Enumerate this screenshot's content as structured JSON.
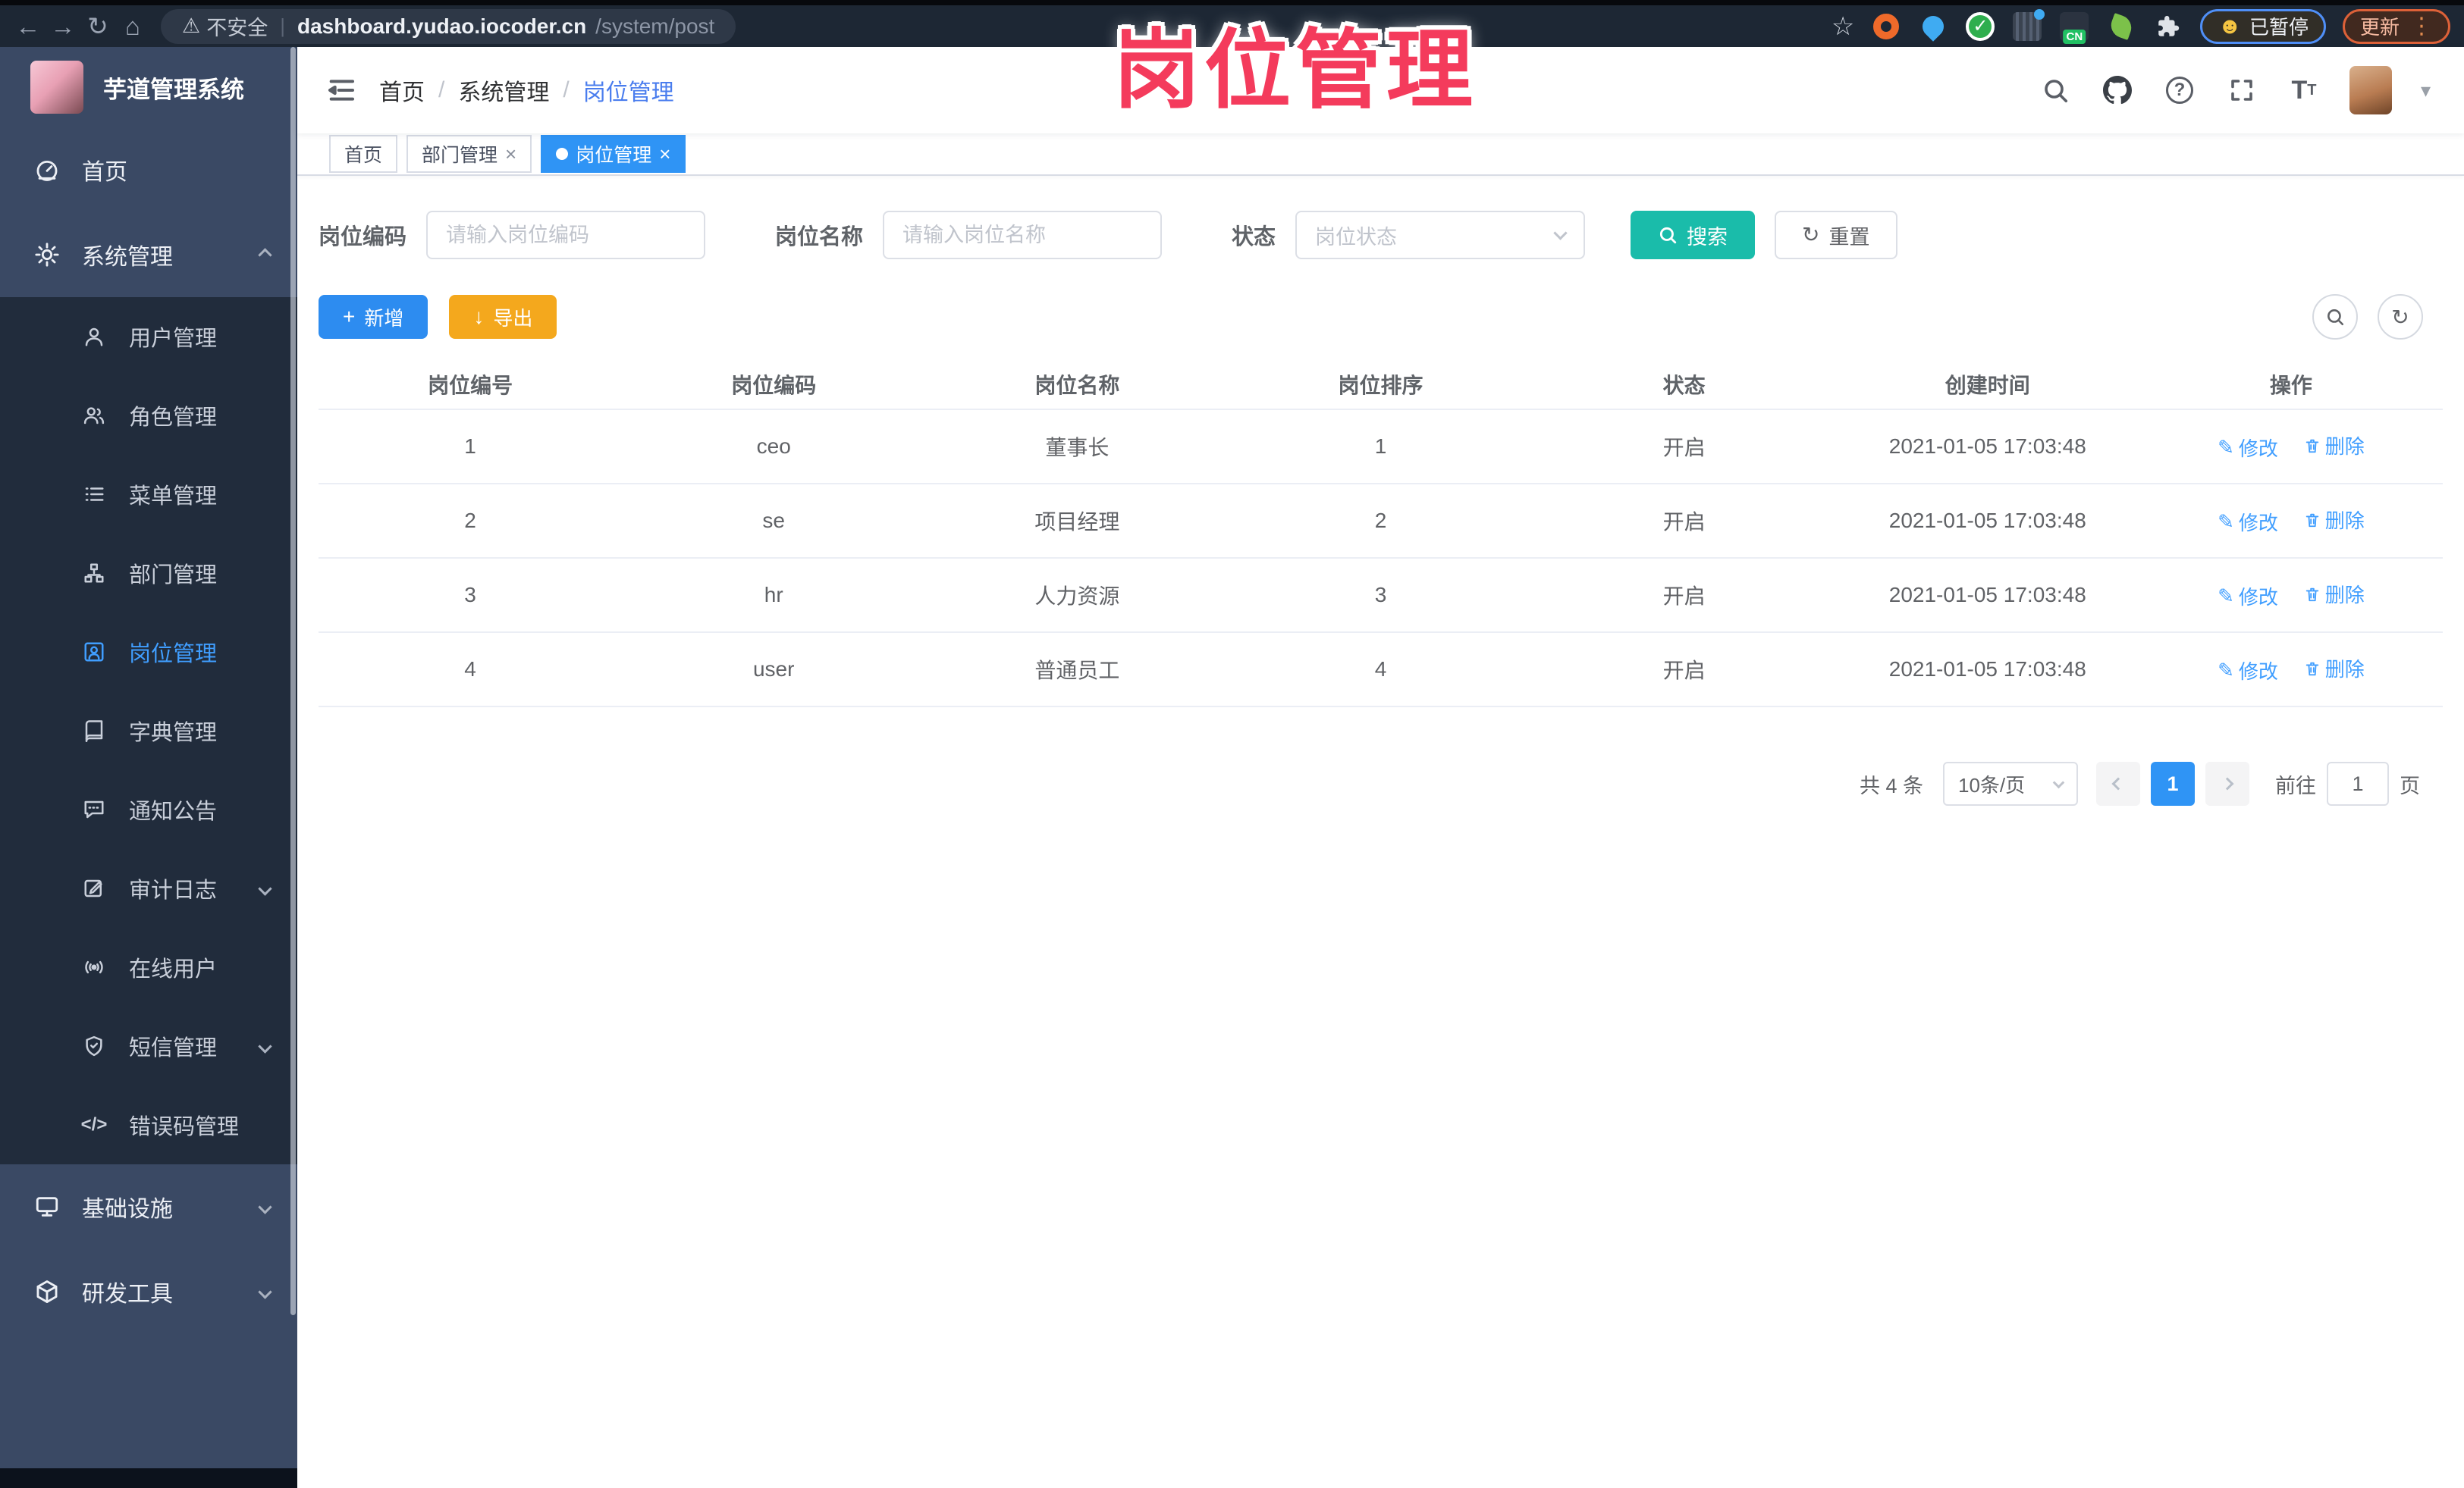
{
  "colors": {
    "primary": "#409eff",
    "tab_active": "#2f94f5",
    "search_button": "#1abcaa",
    "export_button": "#f4a81d",
    "annotation": "#f43b5c",
    "sidebar_bg": "#3a4964",
    "submenu_bg": "#212c3c"
  },
  "annotation": {
    "title": "岗位管理"
  },
  "browser": {
    "security_label": "不安全",
    "url_host": "dashboard.yudao.iocoder.cn",
    "url_path": "/system/post",
    "paused_label": "已暂停",
    "update_label": "更新"
  },
  "icons": {
    "back": "←",
    "forward": "→",
    "reload": "↻",
    "home": "⌂",
    "warning": "⚠",
    "divider": "|",
    "star": "☆",
    "kebab": "⋮",
    "caret": "▾",
    "question": "?",
    "t_big": "T",
    "t_small": "T",
    "check": "✓",
    "smiley": "☻",
    "plus": "+",
    "download": "↓",
    "redo": "↻",
    "edit": "✎",
    "close": "×",
    "slash": "/",
    "code": "</>"
  },
  "sidebar": {
    "app_title": "芋道管理系统",
    "menu": [
      {
        "label": "首页"
      },
      {
        "label": "系统管理"
      },
      {
        "label": "用户管理"
      },
      {
        "label": "角色管理"
      },
      {
        "label": "菜单管理"
      },
      {
        "label": "部门管理"
      },
      {
        "label": "岗位管理"
      },
      {
        "label": "字典管理"
      },
      {
        "label": "通知公告"
      },
      {
        "label": "审计日志"
      },
      {
        "label": "在线用户"
      },
      {
        "label": "短信管理"
      },
      {
        "label": "错误码管理"
      },
      {
        "label": "基础设施"
      },
      {
        "label": "研发工具"
      }
    ]
  },
  "header": {
    "breadcrumb": [
      "首页",
      "系统管理",
      "岗位管理"
    ]
  },
  "tabs": [
    {
      "label": "首页"
    },
    {
      "label": "部门管理"
    },
    {
      "label": "岗位管理"
    }
  ],
  "filters": {
    "code_label": "岗位编码",
    "code_placeholder": "请输入岗位编码",
    "name_label": "岗位名称",
    "name_placeholder": "请输入岗位名称",
    "status_label": "状态",
    "status_placeholder": "岗位状态",
    "search_label": "搜索",
    "reset_label": "重置"
  },
  "toolbar": {
    "add_label": "新增",
    "export_label": "导出"
  },
  "table": {
    "columns": [
      "岗位编号",
      "岗位编码",
      "岗位名称",
      "岗位排序",
      "状态",
      "创建时间",
      "操作"
    ],
    "edit_label": "修改",
    "delete_label": "删除",
    "rows": [
      {
        "id": "1",
        "code": "ceo",
        "name": "董事长",
        "sort": "1",
        "status": "开启",
        "created": "2021-01-05 17:03:48"
      },
      {
        "id": "2",
        "code": "se",
        "name": "项目经理",
        "sort": "2",
        "status": "开启",
        "created": "2021-01-05 17:03:48"
      },
      {
        "id": "3",
        "code": "hr",
        "name": "人力资源",
        "sort": "3",
        "status": "开启",
        "created": "2021-01-05 17:03:48"
      },
      {
        "id": "4",
        "code": "user",
        "name": "普通员工",
        "sort": "4",
        "status": "开启",
        "created": "2021-01-05 17:03:48"
      }
    ]
  },
  "pagination": {
    "total_text": "共 4 条",
    "page_size": "10条/页",
    "current_page": "1",
    "goto_label": "前往",
    "goto_value": "1",
    "page_unit": "页"
  }
}
